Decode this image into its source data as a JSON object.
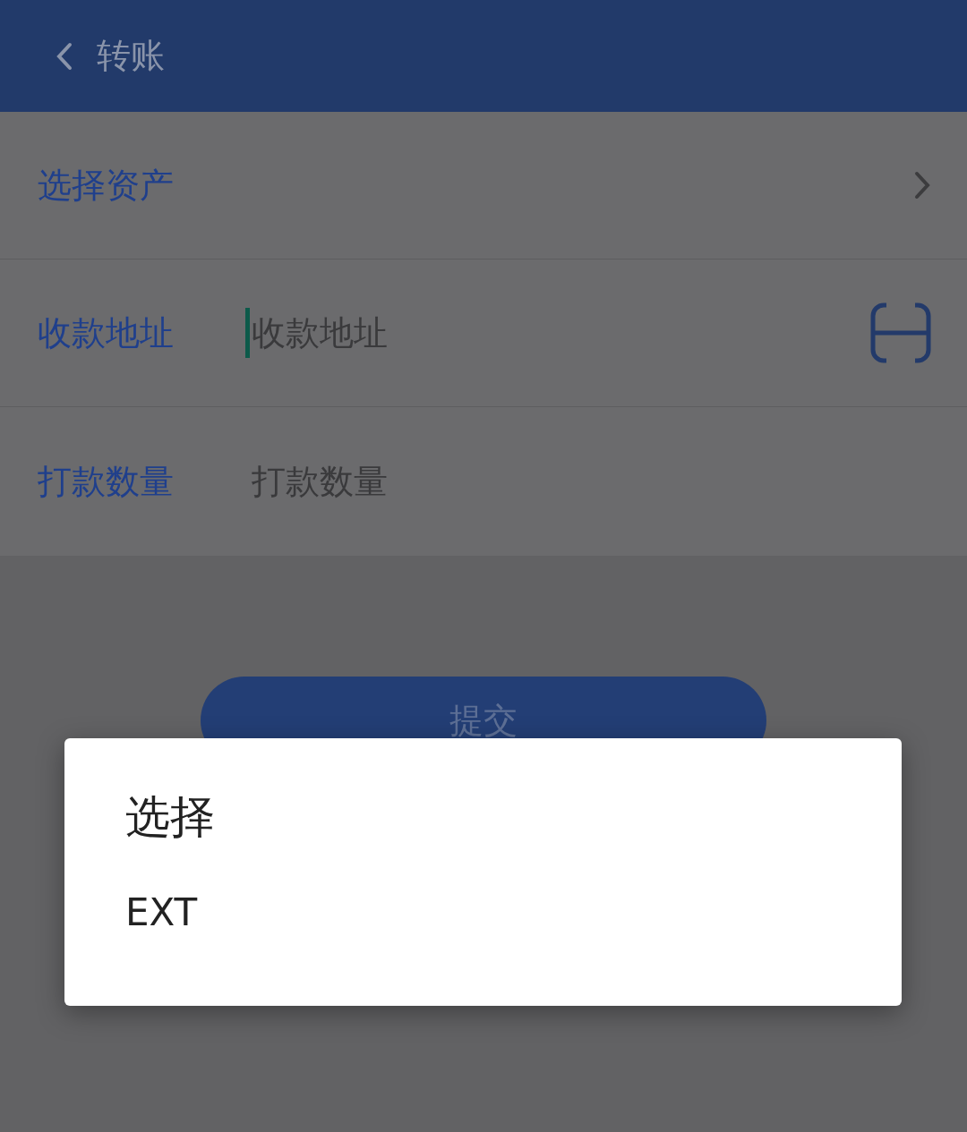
{
  "header": {
    "title": "转账"
  },
  "form": {
    "rows": [
      {
        "kind": "select",
        "label": "选择资产"
      },
      {
        "kind": "scan",
        "label": "收款地址",
        "placeholder": "收款地址",
        "focused": true
      },
      {
        "kind": "input",
        "label": "打款数量",
        "placeholder": "打款数量",
        "focused": false
      }
    ]
  },
  "submit_button": {
    "label": "提交"
  },
  "dialog": {
    "title": "选择",
    "options": [
      {
        "label": "EXT"
      }
    ]
  }
}
